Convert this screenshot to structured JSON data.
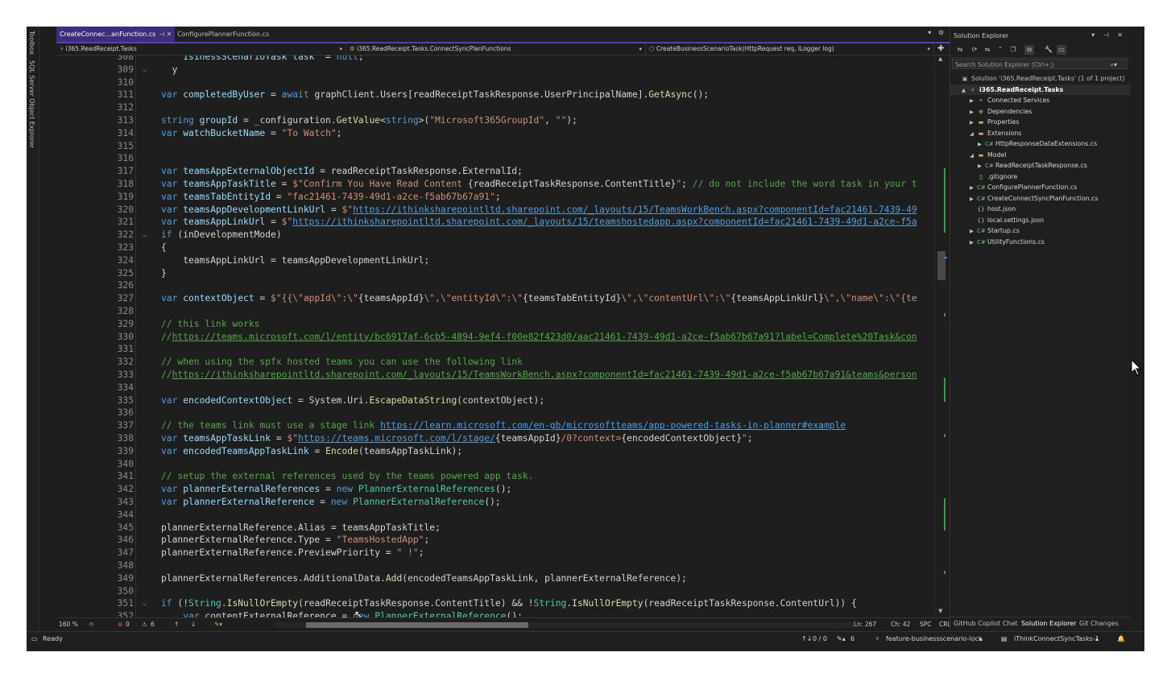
{
  "left_strip": {
    "tabs": [
      "Toolbox",
      "SQL Server Object Explorer"
    ]
  },
  "tabs": [
    {
      "label": "CreateConnec...anFunction.cs",
      "active": true
    },
    {
      "label": "ConfigurePlannerFunction.cs",
      "active": false
    }
  ],
  "navbar": {
    "project": "i365.ReadReceipt.Tasks",
    "class": "i365.ReadReceipt.Tasks.ConnectSyncPlanFunctions",
    "member": "CreateBusinessScenarioTask(HttpRequest req, ILogger log)"
  },
  "code": {
    "lines": [
      {
        "n": "308",
        "fold": "",
        "parts": [
          [
            "",
            "    "
          ],
          [
            "vr",
            "isinessScenarioTask task"
          ],
          [
            "",
            "  = "
          ],
          [
            "kw",
            "null"
          ],
          [
            "",
            ";"
          ]
        ]
      },
      {
        "n": "309",
        "fold": "v",
        "parts": [
          [
            "",
            "  y"
          ]
        ]
      },
      {
        "n": "310",
        "fold": "",
        "parts": []
      },
      {
        "n": "311",
        "fold": "",
        "parts": [
          [
            "kw",
            "var"
          ],
          [
            "",
            " "
          ],
          [
            "vr",
            "completedByUser"
          ],
          [
            "",
            " = "
          ],
          [
            "kw",
            "await"
          ],
          [
            "",
            " graphClient.Users[readReceiptTaskResponse.UserPrincipalName]."
          ],
          [
            "mt",
            "GetAsync"
          ],
          [
            "",
            "();"
          ]
        ]
      },
      {
        "n": "312",
        "fold": "",
        "parts": []
      },
      {
        "n": "313",
        "fold": "",
        "parts": [
          [
            "kw",
            "string"
          ],
          [
            "",
            " "
          ],
          [
            "vr",
            "groupId"
          ],
          [
            "",
            " = _configuration."
          ],
          [
            "mt",
            "GetValue"
          ],
          [
            "",
            "<"
          ],
          [
            "kw",
            "string"
          ],
          [
            "",
            ">("
          ],
          [
            "str",
            "\"Microsoft365GroupId\""
          ],
          [
            "",
            ", "
          ],
          [
            "str",
            "\"\""
          ],
          [
            "",
            ");"
          ]
        ]
      },
      {
        "n": "314",
        "fold": "",
        "parts": [
          [
            "kw",
            "var"
          ],
          [
            "",
            " "
          ],
          [
            "vr",
            "watchBucketName"
          ],
          [
            "",
            " = "
          ],
          [
            "str",
            "\"To Watch\""
          ],
          [
            "",
            ";"
          ]
        ]
      },
      {
        "n": "315",
        "fold": "",
        "parts": []
      },
      {
        "n": "316",
        "fold": "",
        "parts": []
      },
      {
        "n": "317",
        "fold": "",
        "parts": [
          [
            "kw",
            "var"
          ],
          [
            "",
            " "
          ],
          [
            "vr",
            "teamsAppExternalObjectId"
          ],
          [
            "",
            " = readReceiptTaskResponse.ExternalId;"
          ]
        ]
      },
      {
        "n": "318",
        "fold": "",
        "parts": [
          [
            "kw",
            "var"
          ],
          [
            "",
            " "
          ],
          [
            "vr",
            "teamsAppTaskTitle"
          ],
          [
            "",
            " = "
          ],
          [
            "str",
            "$\"Confirm You Have Read Content "
          ],
          [
            "",
            "{readReceiptTaskResponse.ContentTitle}"
          ],
          [
            "str",
            "\""
          ],
          [
            "",
            "; "
          ],
          [
            "cm",
            "// do not include the word task in your t"
          ]
        ]
      },
      {
        "n": "319",
        "fold": "",
        "parts": [
          [
            "kw",
            "var"
          ],
          [
            "",
            " "
          ],
          [
            "vr",
            "teamsTabEntityId"
          ],
          [
            "",
            " = "
          ],
          [
            "str",
            "\"fac21461-7439-49d1-a2ce-f5ab67b67a91\""
          ],
          [
            "",
            ";"
          ]
        ]
      },
      {
        "n": "320",
        "fold": "",
        "parts": [
          [
            "kw",
            "var"
          ],
          [
            "",
            " "
          ],
          [
            "vr",
            "teamsAppDevelopmentLinkUrl"
          ],
          [
            "",
            " = "
          ],
          [
            "str",
            "$\""
          ],
          [
            "lnk",
            "https://ithinksharepointltd.sharepoint.com/_layouts/15/TeamsWorkBench.aspx?componentId=fac21461-7439-49"
          ]
        ]
      },
      {
        "n": "321",
        "fold": "",
        "parts": [
          [
            "kw",
            "var"
          ],
          [
            "",
            " "
          ],
          [
            "vr",
            "teamsAppLinkUrl"
          ],
          [
            "",
            " = "
          ],
          [
            "str",
            "$\""
          ],
          [
            "lnk",
            "https://ithinksharepointltd.sharepoint.com/_layouts/15/teamshostedapp.aspx?componentId=fac21461-7439-49d1-a2ce-f5a"
          ]
        ]
      },
      {
        "n": "322",
        "fold": "v",
        "parts": [
          [
            "kw",
            "if"
          ],
          [
            "",
            " (inDevelopmentMode)"
          ]
        ]
      },
      {
        "n": "323",
        "fold": "",
        "parts": [
          [
            "",
            "{"
          ]
        ]
      },
      {
        "n": "324",
        "fold": "",
        "parts": [
          [
            "",
            "    teamsAppLinkUrl = teamsAppDevelopmentLinkUrl;"
          ]
        ]
      },
      {
        "n": "325",
        "fold": "",
        "parts": [
          [
            "",
            "}"
          ]
        ]
      },
      {
        "n": "326",
        "fold": "",
        "parts": []
      },
      {
        "n": "327",
        "fold": "",
        "parts": [
          [
            "kw",
            "var"
          ],
          [
            "",
            " "
          ],
          [
            "vr",
            "contextObject"
          ],
          [
            "",
            " = "
          ],
          [
            "str",
            "$\"{{\\\"appId\\\":\\\""
          ],
          [
            "",
            "{teamsAppId}"
          ],
          [
            "str",
            "\\\",\\\"entityId\\\":\\\""
          ],
          [
            "",
            "{teamsTabEntityId}"
          ],
          [
            "str",
            "\\\",\\\"contentUrl\\\":\\\""
          ],
          [
            "",
            "{teamsAppLinkUrl}"
          ],
          [
            "str",
            "\\\",\\\"name\\\":\\\"{te"
          ]
        ]
      },
      {
        "n": "328",
        "fold": "",
        "parts": []
      },
      {
        "n": "329",
        "fold": "",
        "parts": [
          [
            "cm",
            "// this link works"
          ]
        ]
      },
      {
        "n": "330",
        "fold": "",
        "parts": [
          [
            "cm",
            "//"
          ],
          [
            "cmlnk",
            "https://teams.microsoft.com/l/entity/bc6917af-6cb5-4894-9ef4-f00e82f423d0/aac21461-7439-49d1-a2ce-f5ab67b67a91?label=Complete%20Task&con"
          ]
        ]
      },
      {
        "n": "331",
        "fold": "",
        "parts": []
      },
      {
        "n": "332",
        "fold": "",
        "parts": [
          [
            "cm",
            "// when using the spfx hosted teams you can use the following link"
          ]
        ]
      },
      {
        "n": "333",
        "fold": "",
        "parts": [
          [
            "cm",
            "//"
          ],
          [
            "cmlnk",
            "https://ithinksharepointltd.sharepoint.com/_layouts/15/TeamsWorkBench.aspx?componentId=fac21461-7439-49d1-a2ce-f5ab67b67a91&teams&person"
          ]
        ]
      },
      {
        "n": "334",
        "fold": "",
        "parts": []
      },
      {
        "n": "335",
        "fold": "",
        "parts": [
          [
            "kw",
            "var"
          ],
          [
            "",
            " "
          ],
          [
            "vr",
            "encodedContextObject"
          ],
          [
            "",
            " = System.Uri."
          ],
          [
            "mt",
            "EscapeDataString"
          ],
          [
            "",
            "(contextObject);"
          ]
        ]
      },
      {
        "n": "336",
        "fold": "",
        "parts": []
      },
      {
        "n": "337",
        "fold": "",
        "parts": [
          [
            "cm",
            "// the teams link must use a stage link "
          ],
          [
            "lnk",
            "https://learn.microsoft.com/en-gb/microsoftteams/app-powered-tasks-in-planner#example"
          ]
        ]
      },
      {
        "n": "338",
        "fold": "",
        "parts": [
          [
            "kw",
            "var"
          ],
          [
            "",
            " "
          ],
          [
            "vr",
            "teamsAppTaskLink"
          ],
          [
            "",
            " = "
          ],
          [
            "str",
            "$\""
          ],
          [
            "lnk",
            "https://teams.microsoft.com/l/stage/"
          ],
          [
            "",
            "{teamsAppId}"
          ],
          [
            "str",
            "/0?context="
          ],
          [
            "",
            "{encodedContextObject}"
          ],
          [
            "str",
            "\""
          ],
          [
            "",
            ";"
          ]
        ]
      },
      {
        "n": "339",
        "fold": "",
        "parts": [
          [
            "kw",
            "var"
          ],
          [
            "",
            " "
          ],
          [
            "vr",
            "encodedTeamsAppTaskLink"
          ],
          [
            "",
            " = "
          ],
          [
            "mt",
            "Encode"
          ],
          [
            "",
            "(teamsAppTaskLink);"
          ]
        ]
      },
      {
        "n": "340",
        "fold": "",
        "parts": []
      },
      {
        "n": "341",
        "fold": "",
        "parts": [
          [
            "cm",
            "// setup the external references used by the teams powered app task."
          ]
        ]
      },
      {
        "n": "342",
        "fold": "",
        "parts": [
          [
            "kw",
            "var"
          ],
          [
            "",
            " "
          ],
          [
            "vr",
            "plannerExternalReferences"
          ],
          [
            "",
            " = "
          ],
          [
            "kw",
            "new"
          ],
          [
            "",
            " "
          ],
          [
            "ty",
            "PlannerExternalReferences"
          ],
          [
            "",
            "();"
          ]
        ]
      },
      {
        "n": "343",
        "fold": "",
        "parts": [
          [
            "kw",
            "var"
          ],
          [
            "",
            " "
          ],
          [
            "vr",
            "plannerExternalReference"
          ],
          [
            "",
            " = "
          ],
          [
            "kw",
            "new"
          ],
          [
            "",
            " "
          ],
          [
            "ty",
            "PlannerExternalReference"
          ],
          [
            "",
            "();"
          ]
        ]
      },
      {
        "n": "344",
        "fold": "",
        "parts": []
      },
      {
        "n": "345",
        "fold": "",
        "parts": [
          [
            "",
            "plannerExternalReference.Alias = teamsAppTaskTitle;"
          ]
        ]
      },
      {
        "n": "346",
        "fold": "",
        "parts": [
          [
            "",
            "plannerExternalReference.Type = "
          ],
          [
            "str",
            "\"TeamsHostedApp\""
          ],
          [
            "",
            ";"
          ]
        ]
      },
      {
        "n": "347",
        "fold": "",
        "parts": [
          [
            "",
            "plannerExternalReference.PreviewPriority = "
          ],
          [
            "str",
            "\" !\""
          ],
          [
            "",
            ";"
          ]
        ]
      },
      {
        "n": "348",
        "fold": "",
        "parts": []
      },
      {
        "n": "349",
        "fold": "",
        "parts": [
          [
            "",
            "plannerExternalReferences.AdditionalData."
          ],
          [
            "mt",
            "Add"
          ],
          [
            "",
            "(encodedTeamsAppTaskLink, plannerExternalReference);"
          ]
        ]
      },
      {
        "n": "350",
        "fold": "",
        "parts": []
      },
      {
        "n": "351",
        "fold": "v",
        "parts": [
          [
            "kw",
            "if"
          ],
          [
            "",
            " (!"
          ],
          [
            "ty",
            "String"
          ],
          [
            "",
            "."
          ],
          [
            "mt",
            "IsNullOrEmpty"
          ],
          [
            "",
            "(readReceiptTaskResponse.ContentTitle) && !"
          ],
          [
            "ty",
            "String"
          ],
          [
            "",
            "."
          ],
          [
            "mt",
            "IsNullOrEmpty"
          ],
          [
            "",
            "(readReceiptTaskResponse.ContentUrl)) {"
          ]
        ]
      },
      {
        "n": "352",
        "fold": "",
        "parts": [
          [
            "",
            "    "
          ],
          [
            "kw",
            "var"
          ],
          [
            "",
            " contentExternalReference = "
          ],
          [
            "kw",
            "new"
          ],
          [
            "",
            " "
          ],
          [
            "ty",
            "PlannerExternalReference"
          ],
          [
            "",
            "();"
          ]
        ]
      }
    ]
  },
  "editor_status": {
    "zoom": "160 %",
    "errors": "0",
    "warnings": "6",
    "line": "Ln: 267",
    "col": "Ch: 42",
    "spc": "SPC",
    "crlf": "CRLF"
  },
  "solution_explorer": {
    "title": "Solution Explorer",
    "search_placeholder": "Search Solution Explorer (Ctrl+;)",
    "items": [
      {
        "label": "Solution 'i365.ReadReceipt.Tasks' (1 of 1 project)",
        "depth": 0,
        "exp": "",
        "icon": "solution-icon",
        "color": "#c0c0c0"
      },
      {
        "label": "i365.ReadReceipt.Tasks",
        "depth": 1,
        "exp": "▲",
        "icon": "csharp-project-icon",
        "color": "#ffffff",
        "bold": true,
        "selected": true
      },
      {
        "label": "Connected Services",
        "depth": 2,
        "exp": "▶",
        "icon": "connected-services-icon",
        "color": "#d8d8d8"
      },
      {
        "label": "Dependencies",
        "depth": 2,
        "exp": "▶",
        "icon": "dependencies-icon",
        "color": "#d8d8d8"
      },
      {
        "label": "Properties",
        "depth": 2,
        "exp": "▶",
        "icon": "folder-icon",
        "color": "#d8d8d8"
      },
      {
        "label": "Extensions",
        "depth": 2,
        "exp": "◢",
        "icon": "folder-icon",
        "color": "#d8d8d8"
      },
      {
        "label": "HttpResponseDataExtensions.cs",
        "depth": 3,
        "exp": "▶",
        "icon": "csharp-file-icon",
        "color": "#d8d8d8"
      },
      {
        "label": "Model",
        "depth": 2,
        "exp": "◢",
        "icon": "folder-icon",
        "color": "#d8d8d8"
      },
      {
        "label": "ReadReceiptTaskResponse.cs",
        "depth": 3,
        "exp": "▶",
        "icon": "csharp-file-icon",
        "color": "#d8d8d8"
      },
      {
        "label": ".gitignore",
        "depth": 2,
        "exp": "",
        "icon": "file-icon",
        "color": "#d8d8d8"
      },
      {
        "label": "ConfigurePlannerFunction.cs",
        "depth": 2,
        "exp": "▶",
        "icon": "csharp-file-icon",
        "color": "#d8d8d8"
      },
      {
        "label": "CreateConnectSyncPlanFunction.cs",
        "depth": 2,
        "exp": "▶",
        "icon": "csharp-file-icon",
        "color": "#d8d8d8"
      },
      {
        "label": "host.json",
        "depth": 2,
        "exp": "",
        "icon": "json-file-icon",
        "color": "#d8d8d8"
      },
      {
        "label": "local.settings.json",
        "depth": 2,
        "exp": "",
        "icon": "json-file-icon",
        "color": "#d8d8d8"
      },
      {
        "label": "Startup.cs",
        "depth": 2,
        "exp": "▶",
        "icon": "csharp-file-icon",
        "color": "#d8d8d8"
      },
      {
        "label": "UtilityFunctions.cs",
        "depth": 2,
        "exp": "▶",
        "icon": "csharp-file-icon",
        "color": "#d8d8d8"
      }
    ],
    "bottom_tabs": [
      "GitHub Copilot Chat",
      "Solution Explorer",
      "Git Changes"
    ]
  },
  "main_status": {
    "ready": "Ready",
    "updown": "0 / 0",
    "pencil_count": "6",
    "branch": "feature-businessscenario-lock",
    "repo": "iThinkConnectSyncTasks-1"
  },
  "colors": {
    "accent": "#5b3bc4",
    "keyword": "#569cd6",
    "string": "#ce9178",
    "comment": "#57a64a",
    "type": "#4ec9b0",
    "method": "#dcdcaa"
  }
}
